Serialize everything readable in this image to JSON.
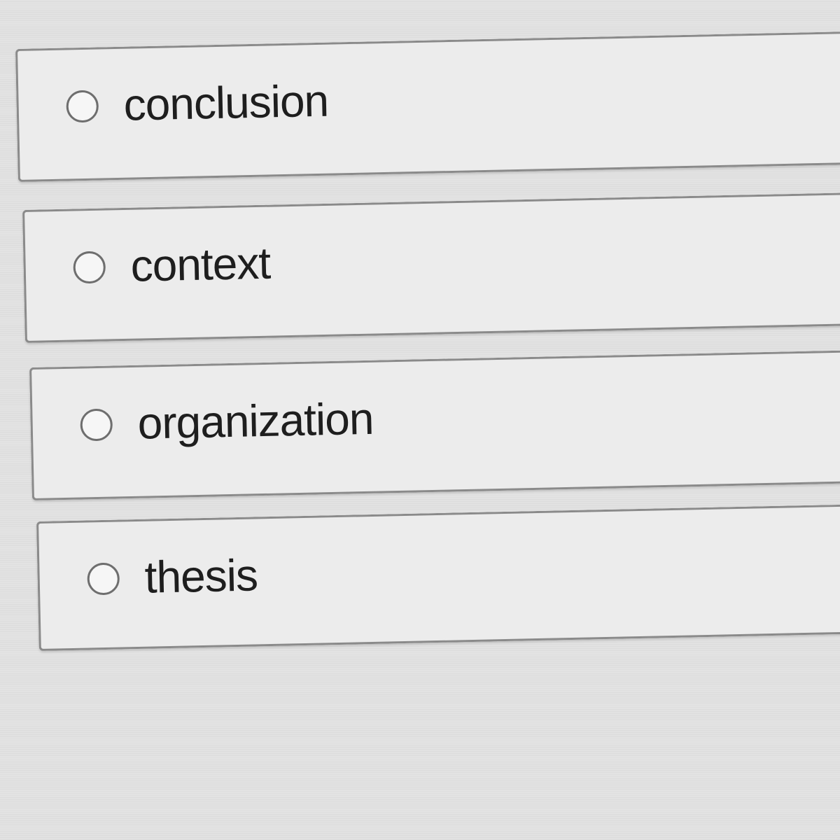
{
  "question": {
    "options": [
      {
        "label": "conclusion",
        "selected": false
      },
      {
        "label": "context",
        "selected": false
      },
      {
        "label": "organization",
        "selected": false
      },
      {
        "label": "thesis",
        "selected": false
      }
    ]
  },
  "colors": {
    "background": "#e3e3e3",
    "option_fill": "#ececec",
    "option_border": "#8a8a8a",
    "text": "#1e1e1e"
  }
}
